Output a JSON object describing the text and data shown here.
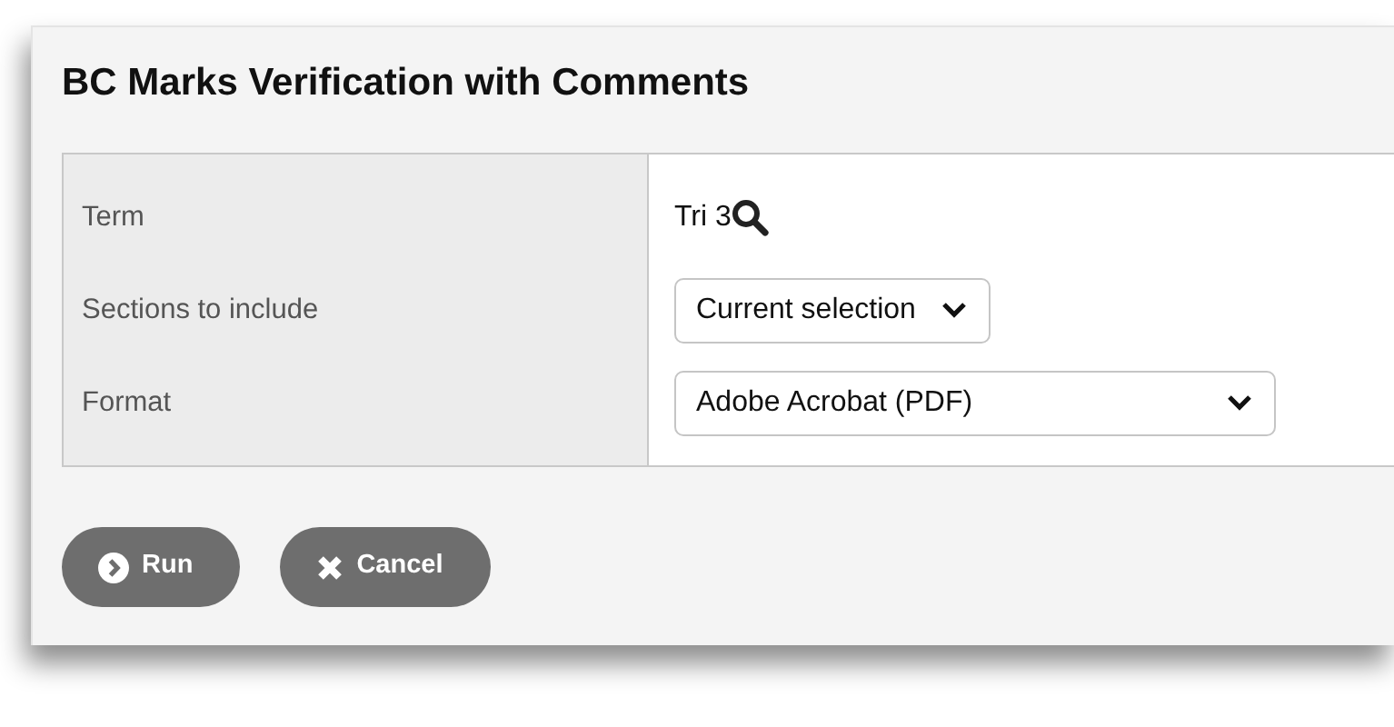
{
  "dialog": {
    "title": "BC Marks Verification with Comments"
  },
  "fields": [
    {
      "label": "Term",
      "kind": "lookup",
      "value": "Tri 3"
    },
    {
      "label": "Sections to include",
      "kind": "select",
      "value": "Current selection",
      "wide": false
    },
    {
      "label": "Format",
      "kind": "select",
      "value": "Adobe Acrobat (PDF)",
      "wide": true
    }
  ],
  "buttons": [
    {
      "label": "Run",
      "kind": "run"
    },
    {
      "label": "Cancel",
      "kind": "cancel"
    }
  ]
}
